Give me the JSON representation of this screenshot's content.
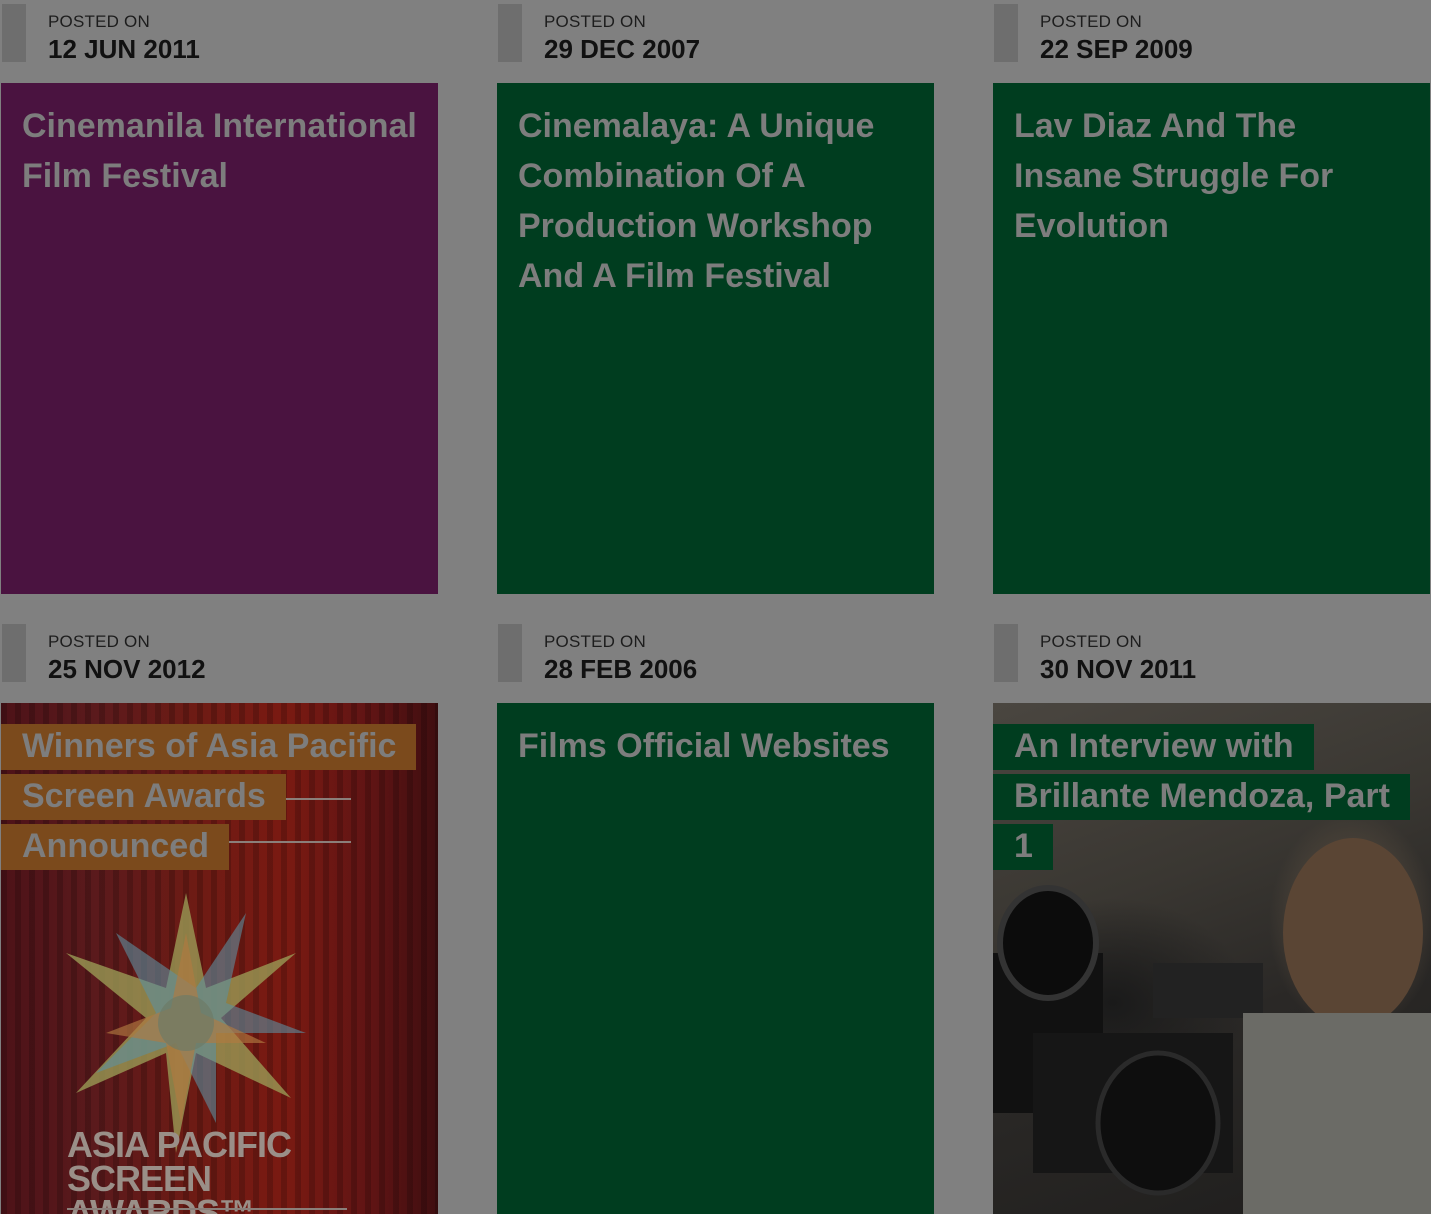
{
  "posts": [
    {
      "posted_label": "POSTED ON",
      "date": "12 JUN 2011",
      "title": "Cinemanila International Film Festival",
      "color": "#4a1340"
    },
    {
      "posted_label": "POSTED ON",
      "date": "29 DEC 2007",
      "title": "Cinemalaya: A Unique Combination Of A Production Workshop And A Film Festival",
      "color": "#003d1f"
    },
    {
      "posted_label": "POSTED ON",
      "date": "22 SEP 2009",
      "title": "Lav Diaz And The Insane Struggle For Evolution",
      "color": "#003d1f"
    },
    {
      "posted_label": "POSTED ON",
      "date": "25 NOV 2012",
      "title": "Winners of Asia Pacific Screen Awards Announced",
      "color": "#7b4a1c",
      "image": "asia-pacific-screen-awards-poster",
      "image_text": "ASIA PACIFIC SCREEN AWARDS™"
    },
    {
      "posted_label": "POSTED ON",
      "date": "28 FEB 2006",
      "title": "Films Official Websites",
      "color": "#003d1f"
    },
    {
      "posted_label": "POSTED ON",
      "date": "30 NOV 2011",
      "title": "An Interview with Brillante Mendoza, Part 1",
      "color": "#003d1f",
      "image": "man-with-film-camera-photo"
    }
  ],
  "colors": {
    "page_background": "#808080",
    "meta_bar": "#6e6e6e",
    "title_text": "#7d7d7d"
  }
}
